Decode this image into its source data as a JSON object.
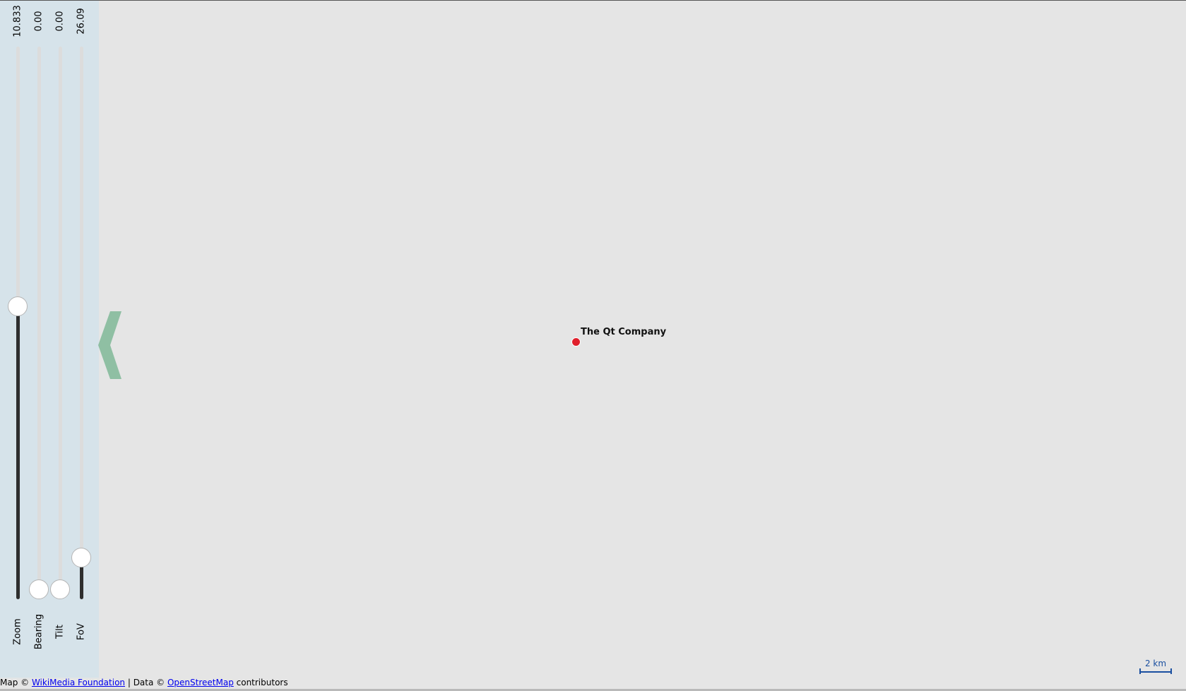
{
  "sliders": [
    {
      "label": "Zoom",
      "value": "10.833",
      "fill_fraction": 0.53
    },
    {
      "label": "Bearing",
      "value": "0.00",
      "fill_fraction": 0.0
    },
    {
      "label": "Tilt",
      "value": "0.00",
      "fill_fraction": 0.0
    },
    {
      "label": "FoV",
      "value": "26.09",
      "fill_fraction": 0.075
    }
  ],
  "marker": {
    "label": "The Qt Company",
    "color": "#e0202c"
  },
  "scale": {
    "label": "2 km",
    "color": "#1a4fa0"
  },
  "attribution": {
    "prefix": "Map © ",
    "map_link": "WikiMedia Foundation",
    "middle": " | Data © ",
    "data_link": "OpenStreetMap",
    "suffix": " contributors"
  },
  "colors": {
    "panel": "#d6e3ea",
    "map": "#e5e5e5",
    "arrow": "#8fbfa3",
    "track_fill": "#2e2e2e"
  }
}
